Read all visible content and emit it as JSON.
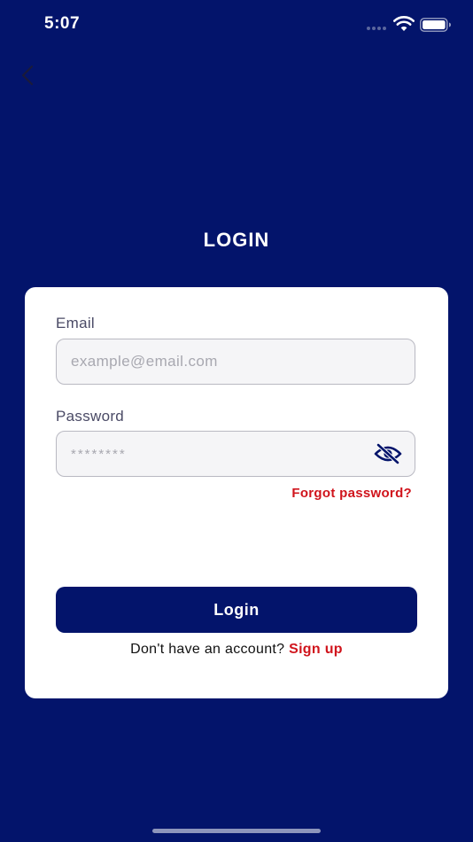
{
  "status_bar": {
    "time": "5:07"
  },
  "nav": {
    "back_icon": "chevron-left-icon"
  },
  "title": "LOGIN",
  "form": {
    "email_label": "Email",
    "email_placeholder": "example@email.com",
    "email_value": "",
    "password_label": "Password",
    "password_placeholder": "********",
    "password_value": "",
    "password_toggle_icon": "eye-off-icon",
    "forgot_password": "Forgot password?",
    "login_button": "Login",
    "signup_prompt": "Don't have an account?",
    "signup_link": "Sign up"
  },
  "colors": {
    "background": "#03146b",
    "card": "#ffffff",
    "accent_red": "#d0141c",
    "button": "#03146b"
  }
}
